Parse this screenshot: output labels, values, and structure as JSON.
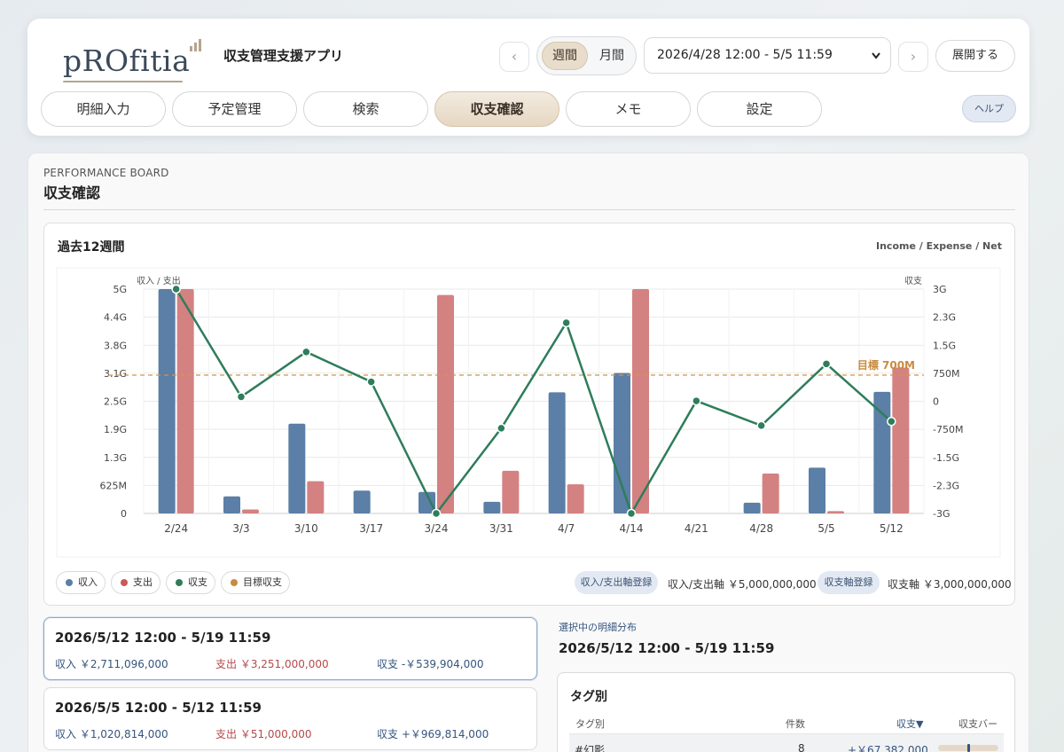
{
  "header": {
    "logo_text": "pROfitia",
    "app_title": "収支管理支援アプリ",
    "prev_arrow": "‹",
    "next_arrow": "›",
    "view_toggle": {
      "weekly": "週間",
      "monthly": "月間",
      "selected": "週間"
    },
    "period_select_value": "2026/4/28 12:00 - 5/5 11:59",
    "expand_button": "展開する",
    "tabs": [
      {
        "label": "明細入力",
        "active": false
      },
      {
        "label": "予定管理",
        "active": false
      },
      {
        "label": "検索",
        "active": false
      },
      {
        "label": "収支確認",
        "active": true
      },
      {
        "label": "メモ",
        "active": false
      },
      {
        "label": "設定",
        "active": false
      }
    ],
    "help_button": "ヘルプ"
  },
  "board": {
    "label": "PERFORMANCE BOARD",
    "title": "収支確認"
  },
  "chart_panel": {
    "title": "過去12週間",
    "subtitle": "Income / Expense / Net",
    "legend": [
      "収入",
      "支出",
      "収支",
      "目標収支"
    ],
    "axis_controls": {
      "income_expense_button": "収入/支出軸登録",
      "income_expense_axis": "収入/支出軸 ￥5,000,000,000",
      "net_button": "収支軸登録",
      "net_axis": "収支軸 ￥3,000,000,000"
    }
  },
  "chart_data": {
    "type": "bar",
    "categories": [
      "2/24",
      "3/3",
      "3/10",
      "3/17",
      "3/24",
      "3/31",
      "4/7",
      "4/14",
      "4/21",
      "4/28",
      "5/5",
      "5/12"
    ],
    "series": [
      {
        "name": "収入",
        "type": "bar",
        "axis": "left",
        "color": "#5b7fa6",
        "values": [
          5000000000,
          380000000,
          2000000000,
          510000000,
          480000000,
          260000000,
          2700000000,
          3130000000,
          0,
          240000000,
          1020814000,
          2711096000
        ]
      },
      {
        "name": "支出",
        "type": "bar",
        "axis": "left",
        "color": "#d48182",
        "values": [
          5000000000,
          90000000,
          720000000,
          0,
          4870000000,
          950000000,
          650000000,
          5000000000,
          0,
          890000000,
          51000000,
          3251000000
        ]
      },
      {
        "name": "収支",
        "type": "line",
        "axis": "right",
        "color": "#2e7d5b",
        "values": [
          3000000000,
          120000000,
          1320000000,
          520000000,
          -3000000000,
          -720000000,
          2100000000,
          -3000000000,
          10000000,
          -650000000,
          1000000000,
          -539904000
        ]
      }
    ],
    "target": {
      "name": "目標収支",
      "value": 700000000,
      "label": "目標 700M",
      "color": "#d6934a"
    },
    "left_axis": {
      "label": "収入 / 支出",
      "ylim": [
        0,
        5000000000
      ],
      "ticks": [
        "0",
        "625M",
        "1.3G",
        "1.9G",
        "2.5G",
        "3.1G",
        "3.8G",
        "4.4G",
        "5G"
      ]
    },
    "right_axis": {
      "label": "収支",
      "ylim": [
        -3000000000,
        3000000000
      ],
      "ticks": [
        "-3G",
        "-2.3G",
        "-1.5G",
        "-750M",
        "0",
        "750M",
        "1.5G",
        "2.3G",
        "3G"
      ]
    },
    "grid": true
  },
  "weeks": [
    {
      "range": "2026/5/12 12:00 - 5/19 11:59",
      "income": "収入 ￥2,711,096,000",
      "expense": "支出 ￥3,251,000,000",
      "net": "収支 -￥539,904,000",
      "selected": true
    },
    {
      "range": "2026/5/5 12:00 - 5/12 11:59",
      "income": "収入 ￥1,020,814,000",
      "expense": "支出 ￥51,000,000",
      "net": "収支 +￥969,814,000",
      "selected": false
    }
  ],
  "detail": {
    "label": "選択中の明細分布",
    "range": "2026/5/12 12:00 - 5/19 11:59",
    "tag_panel": {
      "title": "タグ別",
      "columns": [
        "タグ別",
        "件数",
        "収支▼",
        "収支バー"
      ],
      "rows": [
        {
          "tag": "#幻影",
          "count": "8",
          "net": "+￥67,382,000"
        }
      ]
    }
  },
  "colors": {
    "income": "#5b7fa6",
    "expense": "#d48182",
    "net": "#2e7d5b",
    "target": "#d6934a",
    "accent": "#e8dccb"
  }
}
